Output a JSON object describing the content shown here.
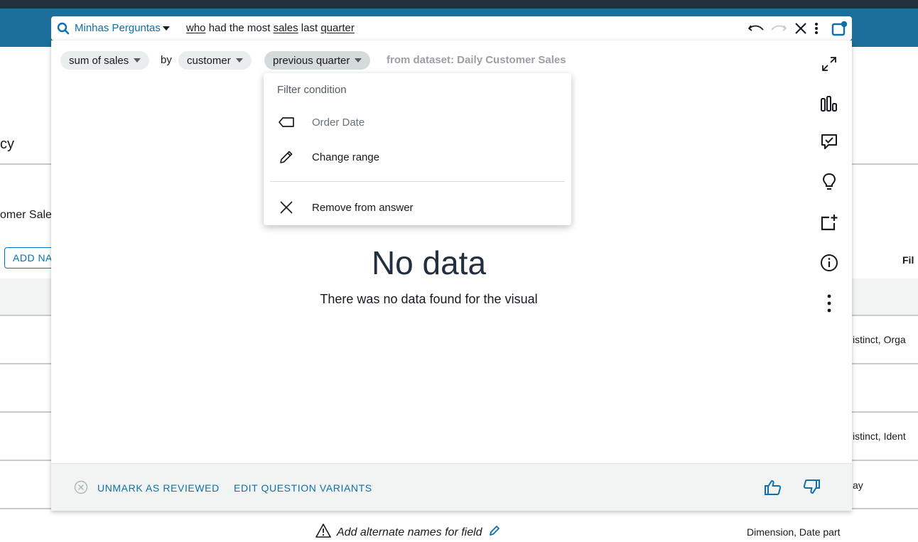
{
  "background": {
    "heading_fragment": "cy",
    "dataset_fragment": "omer Sale",
    "add_button_fragment": "ADD NA",
    "right_header_fragment": "Fil",
    "row_texts": [
      "istinct, Orga",
      "istinct, Ident",
      "ay"
    ],
    "bottom_right": "Dimension, Date part",
    "alt_names": "Add alternate names for field"
  },
  "search": {
    "topic": "Minhas Perguntas",
    "question_words": [
      "who",
      "had the most",
      "sales",
      "last",
      "quarter"
    ]
  },
  "interpretation": {
    "chip_measure": "sum of sales",
    "by": "by",
    "chip_dimension": "customer",
    "chip_filter": "previous quarter",
    "dataset": "from dataset: Daily Customer Sales"
  },
  "menu": {
    "header": "Filter condition",
    "items": [
      {
        "label": "Order Date",
        "icon": "tag-icon"
      },
      {
        "label": "Change range",
        "icon": "pencil-icon"
      },
      {
        "label": "Remove from answer",
        "icon": "close-icon"
      }
    ]
  },
  "result": {
    "title": "No data",
    "message": "There was no data found for the visual"
  },
  "footer": {
    "unmark": "UNMARK AS REVIEWED",
    "edit_variants": "EDIT QUESTION VARIANTS"
  },
  "colors": {
    "top_bar": "#232f3e",
    "header_blue": "#1b6f9a",
    "link_blue": "#0f6fa8"
  }
}
